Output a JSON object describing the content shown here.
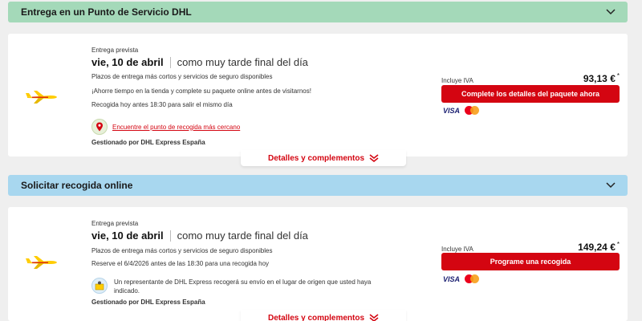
{
  "colors": {
    "brand_red": "#d40511",
    "dhl_yellow": "#ffcc00",
    "header_green": "#a4d9b9",
    "header_blue": "#a8d7ef"
  },
  "sections": [
    {
      "title": "Entrega en un Punto de Servicio DHL",
      "expand_icon": "chevron-down-icon",
      "card": {
        "delivery_label": "Entrega prevista",
        "date": "vie, 10 de abril",
        "date_note": "como muy tarde final del día",
        "line1": "Plazos de entrega más cortos y servicios de seguro disponibles",
        "line2": "¡Ahorre tiempo en la tienda y complete su paquete online antes de visitarnos!",
        "line3": "Recogida hoy antes 18:30 para salir el mismo día",
        "link_text": "Encuentre el punto de recogida más cercano",
        "managed_by": "Gestionado por DHL Express España",
        "iva_label": "Incluye IVA",
        "price": "93,13 €",
        "price_mark": "*",
        "button_label": "Complete los detalles del paquete ahora",
        "payment_visa": "VISA",
        "details_label": "Detalles y complementos"
      }
    },
    {
      "title": "Solicitar recogida online",
      "expand_icon": "chevron-down-icon",
      "card": {
        "delivery_label": "Entrega prevista",
        "date": "vie, 10 de abril",
        "date_note": "como muy tarde final del día",
        "line1": "Plazos de entrega más cortos y servicios de seguro disponibles",
        "line2": "Reserve el 6/4/2026 antes de las 18:30 para una recogida hoy",
        "rep_text": "Un representante de DHL Express recogerá su envío en el lugar de origen que usted haya indicado.",
        "managed_by": "Gestionado por DHL Express España",
        "iva_label": "Incluye IVA",
        "price": "149,24 €",
        "price_mark": "*",
        "button_label": "Programe una recogida",
        "payment_visa": "VISA",
        "details_label": "Detalles y complementos"
      }
    }
  ]
}
